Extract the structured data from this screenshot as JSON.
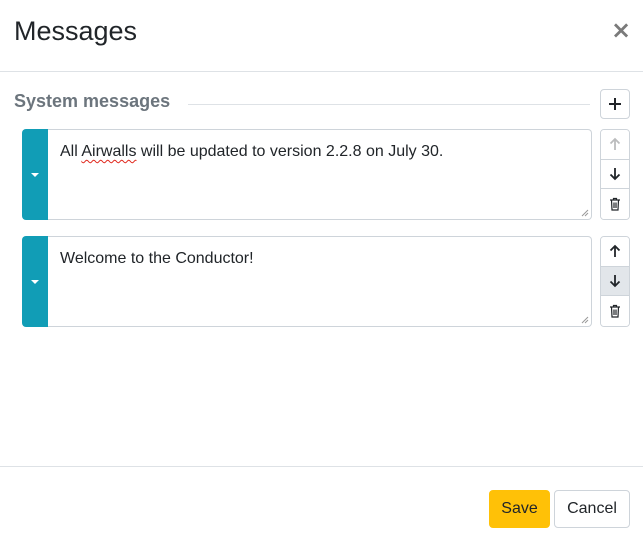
{
  "header": {
    "title": "Messages",
    "close_icon": "close-icon",
    "close_glyph": "×"
  },
  "section": {
    "title": "System messages",
    "add_icon": "plus-icon"
  },
  "messages": [
    {
      "text_before": "All ",
      "text_misspelled": "Airwalls",
      "text_after": " will be updated to version 2.2.8 on July 30.",
      "move_up_enabled": false,
      "move_down_enabled": true
    },
    {
      "text": "Welcome to the Conductor!",
      "move_up_enabled": true,
      "move_down_enabled": true
    }
  ],
  "footer": {
    "save_label": "Save",
    "cancel_label": "Cancel"
  },
  "colors": {
    "accent": "#119db6",
    "save_button": "#ffc107",
    "border": "#ced4da",
    "muted_text": "#6c757d"
  }
}
